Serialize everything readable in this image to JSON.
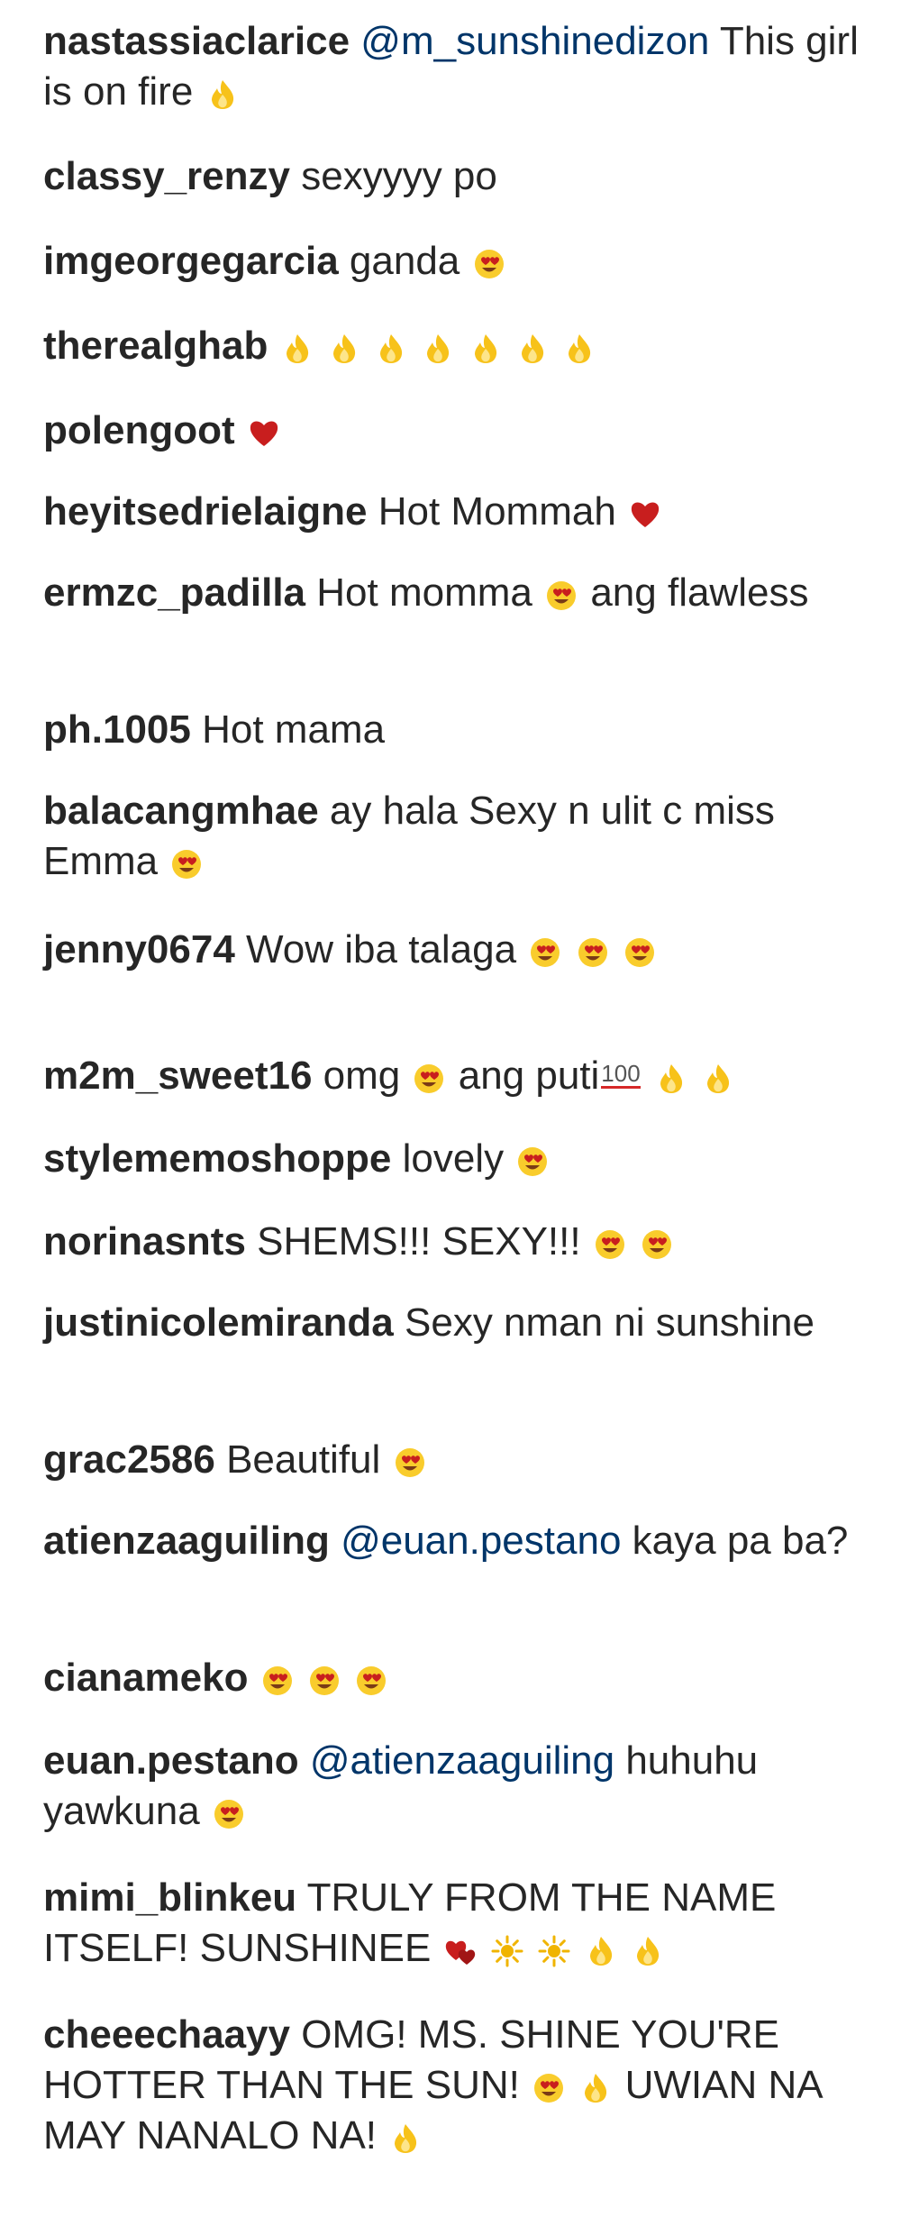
{
  "comments": [
    {
      "user": "nastassiaclarice",
      "parts": [
        {
          "mention": "@m_sunshinedizon"
        },
        {
          "text": "This girl is on fire"
        },
        {
          "emoji": "fire"
        }
      ]
    },
    {
      "user": "classy_renzy",
      "parts": [
        {
          "text": "sexyyyy po"
        }
      ]
    },
    {
      "user": "imgeorgegarcia",
      "parts": [
        {
          "text": "ganda"
        },
        {
          "emoji": "heart-eyes"
        }
      ]
    },
    {
      "user": "therealghab",
      "parts": [
        {
          "emoji": "fire"
        },
        {
          "emoji": "fire"
        },
        {
          "emoji": "fire"
        },
        {
          "emoji": "fire"
        },
        {
          "emoji": "fire"
        },
        {
          "emoji": "fire"
        },
        {
          "emoji": "fire"
        }
      ]
    },
    {
      "user": "polengoot",
      "parts": [
        {
          "emoji": "red-heart"
        }
      ]
    },
    {
      "user": "heyitsedrielaigne",
      "parts": [
        {
          "text": "Hot Mommah"
        },
        {
          "emoji": "red-heart"
        }
      ]
    },
    {
      "user": "ermzc_padilla",
      "parts": [
        {
          "text": "Hot momma"
        },
        {
          "emoji": "heart-eyes"
        },
        {
          "text": "ang flawless"
        }
      ]
    },
    {
      "user": "ph.1005",
      "parts": [
        {
          "text": "Hot mama"
        }
      ]
    },
    {
      "user": "balacangmhae",
      "parts": [
        {
          "text": "ay hala Sexy n ulit c miss Emma"
        },
        {
          "emoji": "heart-eyes"
        }
      ]
    },
    {
      "user": "jenny0674",
      "parts": [
        {
          "text": "Wow iba talaga"
        },
        {
          "emoji": "heart-eyes"
        },
        {
          "emoji": "heart-eyes"
        },
        {
          "emoji": "heart-eyes"
        }
      ]
    },
    {
      "user": "m2m_sweet16",
      "parts": [
        {
          "text": "omg"
        },
        {
          "emoji": "heart-eyes"
        },
        {
          "text": "ang puti"
        },
        {
          "emoji": "hundred"
        },
        {
          "emoji": "fire"
        },
        {
          "emoji": "fire"
        }
      ]
    },
    {
      "user": "stylememoshoppe",
      "parts": [
        {
          "text": "lovely"
        },
        {
          "emoji": "heart-eyes"
        }
      ]
    },
    {
      "user": "norinasnts",
      "parts": [
        {
          "text": "SHEMS!!! SEXY!!!"
        },
        {
          "emoji": "heart-eyes"
        },
        {
          "emoji": "heart-eyes"
        }
      ]
    },
    {
      "user": "justinicolemiranda",
      "parts": [
        {
          "text": "Sexy nman ni sunshine"
        }
      ]
    },
    {
      "user": "grac2586",
      "parts": [
        {
          "text": "Beautiful"
        },
        {
          "emoji": "heart-eyes"
        }
      ]
    },
    {
      "user": "atienzaaguiling",
      "parts": [
        {
          "mention": "@euan.pestano"
        },
        {
          "text": "kaya pa ba?"
        }
      ]
    },
    {
      "user": "cianameko",
      "parts": [
        {
          "emoji": "heart-eyes"
        },
        {
          "emoji": "heart-eyes"
        },
        {
          "emoji": "heart-eyes"
        }
      ]
    },
    {
      "user": "euan.pestano",
      "parts": [
        {
          "mention": "@atienzaaguiling"
        },
        {
          "text": "huhuhu yawkuna"
        },
        {
          "emoji": "heart-eyes"
        }
      ]
    },
    {
      "user": "mimi_blinkeu",
      "parts": [
        {
          "text": "TRULY FROM THE NAME ITSELF! SUNSHINEE"
        },
        {
          "emoji": "two-hearts"
        },
        {
          "emoji": "sun"
        },
        {
          "emoji": "sun"
        },
        {
          "emoji": "fire"
        },
        {
          "emoji": "fire"
        }
      ]
    },
    {
      "user": "cheeechaayy",
      "parts": [
        {
          "text": "OMG! MS. SHINE YOU'RE HOTTER THAN THE SUN!"
        },
        {
          "emoji": "heart-eyes"
        },
        {
          "emoji": "fire"
        },
        {
          "text": "UWIAN NA MAY NANALO NA!"
        },
        {
          "emoji": "fire"
        }
      ]
    }
  ],
  "colors": {
    "text": "#262626",
    "mention": "#003569",
    "background": "#ffffff",
    "fire": "#f7c21a",
    "heart": "#c81e1e",
    "face": "#f9cc2c"
  },
  "emoji_glyphs": {
    "hundred": "100"
  }
}
